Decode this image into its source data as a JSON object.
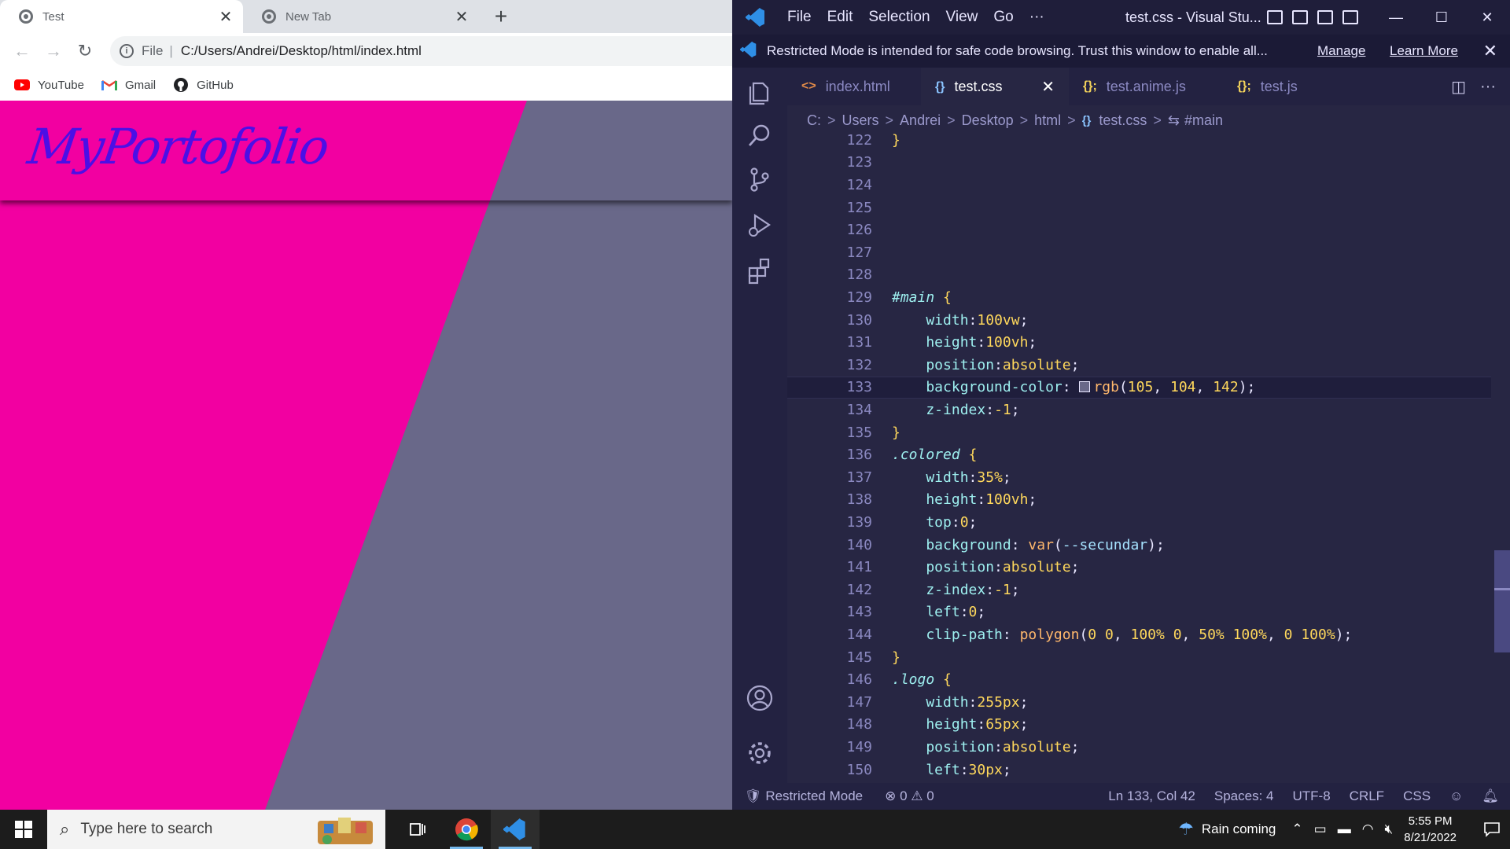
{
  "browser": {
    "tabs": [
      {
        "title": "Test",
        "close": "✕"
      },
      {
        "title": "New Tab",
        "close": "✕"
      }
    ],
    "new_tab": "+",
    "address": {
      "scheme": "File",
      "separator": "|",
      "url": "C:/Users/Andrei/Desktop/html/index.html"
    },
    "bookmarks": [
      {
        "label": "YouTube",
        "icon": "youtube-icon"
      },
      {
        "label": "Gmail",
        "icon": "gmail-icon"
      },
      {
        "label": "GitHub",
        "icon": "github-icon"
      }
    ],
    "page": {
      "logo": "MyPortofolio",
      "colors": {
        "primary": "#f200a1",
        "background": "#696889",
        "logo": "#4b0fe6"
      }
    }
  },
  "vscode": {
    "menu": [
      "File",
      "Edit",
      "Selection",
      "View",
      "Go",
      "···"
    ],
    "window_title": "test.css - Visual Stu...",
    "window_controls": {
      "minimize": "—",
      "maximize": "☐",
      "close": "✕"
    },
    "banner": {
      "text": "Restricted Mode is intended for safe code browsing. Trust this window to enable all...",
      "manage": "Manage",
      "learn_more": "Learn More",
      "close": "✕"
    },
    "tabs": [
      {
        "icon": "<>",
        "label": "index.html"
      },
      {
        "icon": "{}",
        "label": "test.css",
        "close": "✕"
      },
      {
        "icon": "{};",
        "label": "test.anime.js"
      },
      {
        "icon": "{};",
        "label": "test.js"
      }
    ],
    "tab_actions": {
      "split": "◫",
      "more": "···"
    },
    "breadcrumb": [
      "C:",
      "Users",
      "Andrei",
      "Desktop",
      "html",
      "test.css",
      "#main"
    ],
    "breadcrumb_sep": ">",
    "code": [
      {
        "n": "122",
        "t": "}"
      },
      {
        "n": "123",
        "t": ""
      },
      {
        "n": "124",
        "t": ""
      },
      {
        "n": "125",
        "t": ""
      },
      {
        "n": "126",
        "t": ""
      },
      {
        "n": "127",
        "t": ""
      },
      {
        "n": "128",
        "t": ""
      },
      {
        "n": "129",
        "t": "#main {"
      },
      {
        "n": "130",
        "t": "    width:100vw;"
      },
      {
        "n": "131",
        "t": "    height:100vh;"
      },
      {
        "n": "132",
        "t": "    position:absolute;"
      },
      {
        "n": "133",
        "t": "    background-color: rgb(105, 104, 142);"
      },
      {
        "n": "134",
        "t": "    z-index:-1;"
      },
      {
        "n": "135",
        "t": "}"
      },
      {
        "n": "136",
        "t": ".colored {"
      },
      {
        "n": "137",
        "t": "    width:35%;"
      },
      {
        "n": "138",
        "t": "    height:100vh;"
      },
      {
        "n": "139",
        "t": "    top:0;"
      },
      {
        "n": "140",
        "t": "    background: var(--secundar);"
      },
      {
        "n": "141",
        "t": "    position:absolute;"
      },
      {
        "n": "142",
        "t": "    z-index:-1;"
      },
      {
        "n": "143",
        "t": "    left:0;"
      },
      {
        "n": "144",
        "t": "    clip-path: polygon(0 0, 100% 0, 50% 100%, 0 100%);"
      },
      {
        "n": "145",
        "t": "}"
      },
      {
        "n": "146",
        "t": ".logo {"
      },
      {
        "n": "147",
        "t": "    width:255px;"
      },
      {
        "n": "148",
        "t": "    height:65px;"
      },
      {
        "n": "149",
        "t": "    position:absolute;"
      },
      {
        "n": "150",
        "t": "    left:30px;"
      }
    ],
    "current_line": "133",
    "status": {
      "mode": "Restricted Mode",
      "errors": "0",
      "warnings": "0",
      "position": "Ln 133, Col 42",
      "spaces": "Spaces: 4",
      "encoding": "UTF-8",
      "eol": "CRLF",
      "language": "CSS"
    }
  },
  "taskbar": {
    "search_placeholder": "Type here to search",
    "weather": "Rain coming",
    "time": "5:55 PM",
    "date": "8/21/2022"
  }
}
